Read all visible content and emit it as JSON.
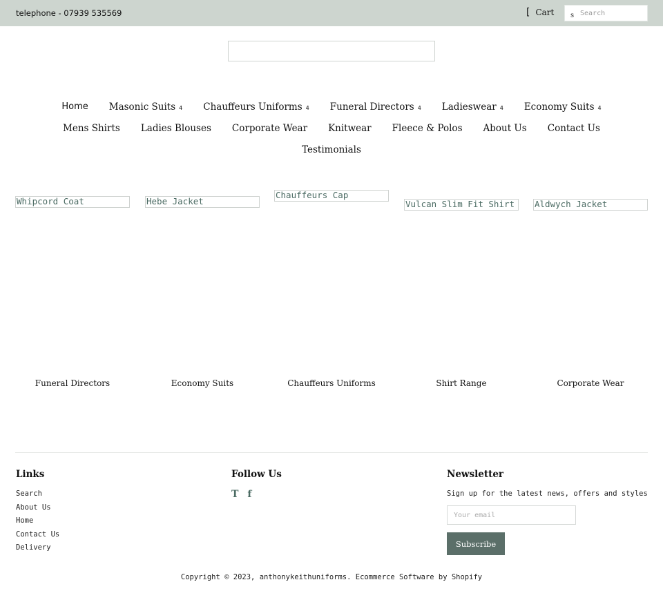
{
  "topbar": {
    "telephone": "telephone - 07939 535569",
    "cart_icon": "[",
    "cart_label": "Cart",
    "search_icon": "s",
    "search_placeholder": "Search"
  },
  "nav": {
    "row1": [
      {
        "label": "Home",
        "has_dropdown": false
      },
      {
        "label": "Masonic Suits",
        "has_dropdown": true
      },
      {
        "label": "Chauffeurs Uniforms",
        "has_dropdown": true
      },
      {
        "label": "Funeral Directors",
        "has_dropdown": true
      },
      {
        "label": "Ladieswear",
        "has_dropdown": true
      },
      {
        "label": "Economy Suits",
        "has_dropdown": true
      }
    ],
    "row2": [
      {
        "label": "Mens Shirts"
      },
      {
        "label": "Ladies Blouses"
      },
      {
        "label": "Corporate Wear"
      },
      {
        "label": "Knitwear"
      },
      {
        "label": "Fleece & Polos"
      },
      {
        "label": "About Us"
      },
      {
        "label": "Contact Us"
      }
    ],
    "row3": [
      {
        "label": "Testimonials"
      }
    ],
    "dropdown_glyph": "4"
  },
  "products": [
    {
      "name": "Whipcord Coat"
    },
    {
      "name": "Hebe Jacket"
    },
    {
      "name": "Chauffeurs Cap"
    },
    {
      "name": "Vulcan Slim Fit Shirt"
    },
    {
      "name": "Aldwych Jacket"
    }
  ],
  "collections": [
    {
      "name": "Funeral Directors"
    },
    {
      "name": "Economy Suits"
    },
    {
      "name": "Chauffeurs Uniforms"
    },
    {
      "name": "Shirt Range"
    },
    {
      "name": "Corporate Wear"
    }
  ],
  "footer": {
    "links_heading": "Links",
    "links": [
      "Search",
      "About Us",
      "Home",
      "Contact Us",
      "Delivery"
    ],
    "follow_heading": "Follow Us",
    "social": [
      {
        "icon": "twitter-icon",
        "glyph": "T"
      },
      {
        "icon": "facebook-icon",
        "glyph": "f"
      }
    ],
    "newsletter_heading": "Newsletter",
    "newsletter_text": "Sign up for the latest news, offers and styles",
    "email_placeholder": "Your email",
    "subscribe_label": "Subscribe",
    "copyright": "Copyright © 2023, anthonykeithuniforms. Ecommerce Software by Shopify"
  }
}
